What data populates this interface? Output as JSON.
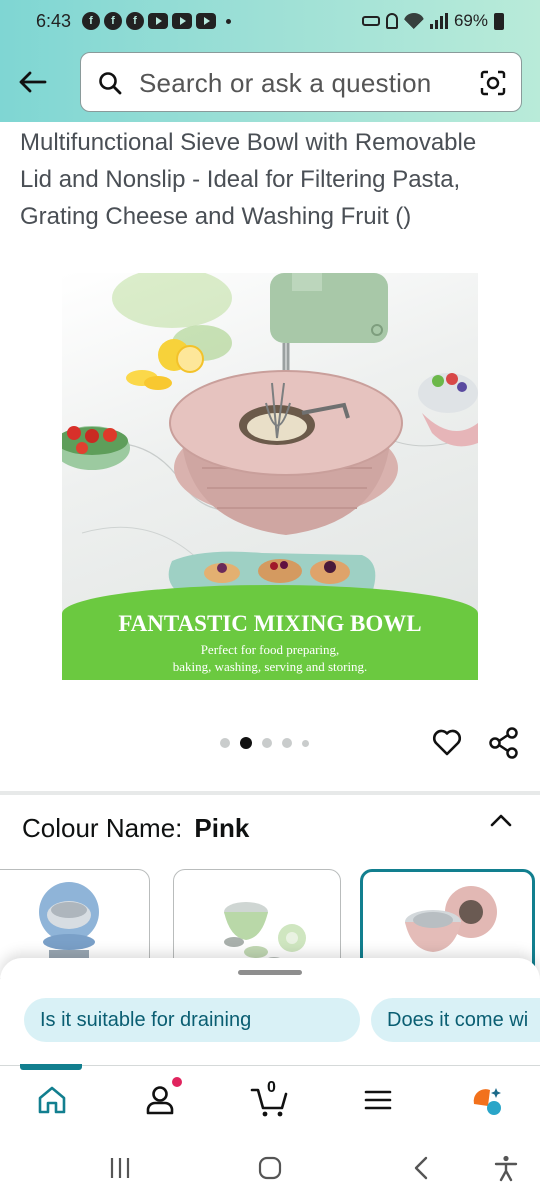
{
  "status_bar": {
    "time": "6:43",
    "battery": "69%",
    "app_icons": [
      "facebook-icon",
      "facebook-icon",
      "facebook-icon",
      "youtube-icon",
      "youtube-icon",
      "youtube-icon"
    ]
  },
  "header": {
    "search_placeholder": "Search or ask a question",
    "accent_gradient": [
      "#7fd6d3",
      "#b9ebd9"
    ]
  },
  "product": {
    "title": "Multifunctional Sieve Bowl with Removable Lid and Nonslip - Ideal for Filtering Pasta, Grating Cheese and Washing Fruit ()",
    "image_banner_title": "FANTASTIC MIXING BOWL",
    "image_banner_subtitle_line1": "Perfect for food preparing,",
    "image_banner_subtitle_line2": "baking, washing, serving and storing.",
    "carousel": {
      "count": 5,
      "active_index": 1
    }
  },
  "variation": {
    "label": "Colour Name:",
    "value": "Pink",
    "swatches": [
      {
        "name": "Blue",
        "selected": false
      },
      {
        "name": "Green",
        "selected": false
      },
      {
        "name": "Pink",
        "selected": true
      }
    ]
  },
  "suggestions": {
    "chips": [
      "Is it suitable for draining",
      "Does it come wi"
    ]
  },
  "bottom_nav": {
    "items": [
      "home-icon",
      "account-icon",
      "cart-icon",
      "menu-icon",
      "rufus-icon"
    ],
    "cart_count": "0",
    "active_index": 0,
    "accent_color": "#127f8f"
  },
  "system_nav": {
    "items": [
      "recents-icon",
      "home-icon",
      "back-icon",
      "accessibility-icon"
    ]
  }
}
